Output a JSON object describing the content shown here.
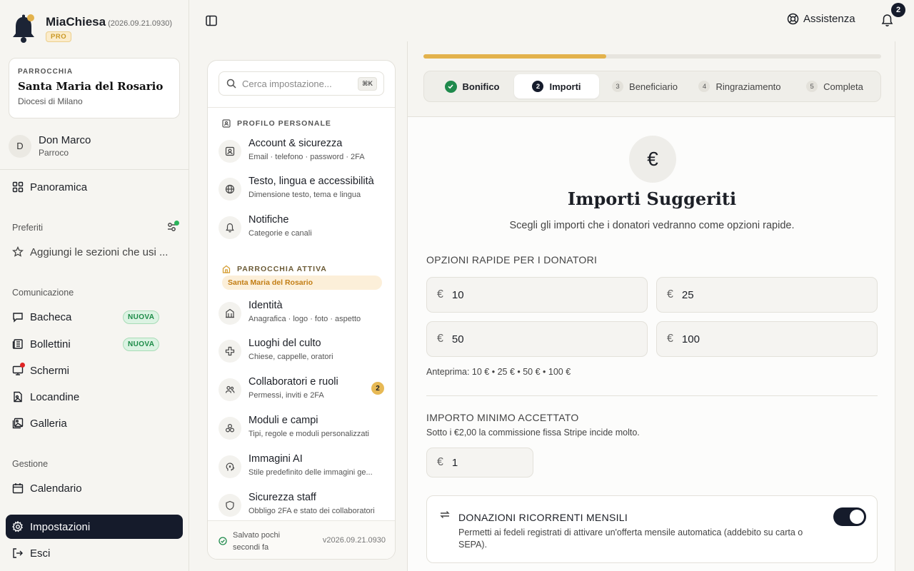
{
  "app": {
    "name": "MiaChiesa",
    "version": "(2026.09.21.0930)",
    "plan": "PRO"
  },
  "parish": {
    "kicker": "PARROCCHIA",
    "name": "Santa Maria del Rosario",
    "diocese": "Diocesi di Milano"
  },
  "user": {
    "initial": "D",
    "name": "Don Marco",
    "role": "Parroco"
  },
  "nav": {
    "overview": "Panoramica",
    "favorites_title": "Preferiti",
    "favorites_hint": "Aggiungi le sezioni che usi ...",
    "communication_title": "Comunicazione",
    "board": "Bacheca",
    "bulletins": "Bollettini",
    "screens": "Schermi",
    "posters": "Locandine",
    "gallery": "Galleria",
    "management_title": "Gestione",
    "calendar": "Calendario",
    "settings": "Impostazioni",
    "logout": "Esci",
    "new_badge": "NUOVA"
  },
  "topbar": {
    "help": "Assistenza",
    "notifications_count": "2"
  },
  "settings_panel": {
    "search_placeholder": "Cerca impostazione...",
    "shortcut": "⌘K",
    "personal_title": "PROFILO PERSONALE",
    "account_title": "Account & sicurezza",
    "account_sub": "Email · telefono · password · 2FA",
    "text_title": "Testo, lingua e accessibilità",
    "text_sub": "Dimensione testo, tema e lingua",
    "notif_title": "Notifiche",
    "notif_sub": "Categorie e canali",
    "active_parish_title": "PARROCCHIA ATTIVA",
    "active_parish_name": "Santa Maria del Rosario",
    "identity_title": "Identità",
    "identity_sub": "Anagrafica · logo · foto · aspetto",
    "places_title": "Luoghi del culto",
    "places_sub": "Chiese, cappelle, oratori",
    "collab_title": "Collaboratori e ruoli",
    "collab_sub": "Permessi, inviti e 2FA",
    "collab_count": "2",
    "forms_title": "Moduli e campi",
    "forms_sub": "Tipi, regole e moduli personalizzati",
    "ai_title": "Immagini AI",
    "ai_sub": "Stile predefinito delle immagini ge...",
    "staff_title": "Sicurezza staff",
    "staff_sub": "Obbligo 2FA e stato dei collaboratori",
    "saved": "Salvato pochi secondi fa",
    "version": "v2026.09.21.0930"
  },
  "wizard": {
    "progress_pct": 40,
    "steps": [
      {
        "num": "✓",
        "label": "Bonifico"
      },
      {
        "num": "2",
        "label": "Importi"
      },
      {
        "num": "3",
        "label": "Beneficiario"
      },
      {
        "num": "4",
        "label": "Ringraziamento"
      },
      {
        "num": "5",
        "label": "Completa"
      }
    ],
    "icon": "€",
    "title": "Importi Suggeriti",
    "subtitle": "Scegli gli importi che i donatori vedranno come opzioni rapide.",
    "quick_label": "OPZIONI RAPIDE PER I DONATORI",
    "currency": "€",
    "amounts": [
      "10",
      "25",
      "50",
      "100"
    ],
    "preview": "Anteprima: 10 € • 25 € • 50 € • 100 €",
    "min_label": "IMPORTO MINIMO ACCETTATO",
    "min_help": "Sotto i €2,00 la commissione fissa Stripe incide molto.",
    "min_value": "1",
    "recurring_title": "DONAZIONI RICORRENTI MENSILI",
    "recurring_desc": "Permetti ai fedeli registrati di attivare un'offerta mensile automatica (addebito su carta o SEPA).",
    "recurring_enabled": true
  },
  "colors": {
    "accent": "#e3b24c",
    "dark": "#151b2b",
    "success": "#1f8a4c"
  }
}
